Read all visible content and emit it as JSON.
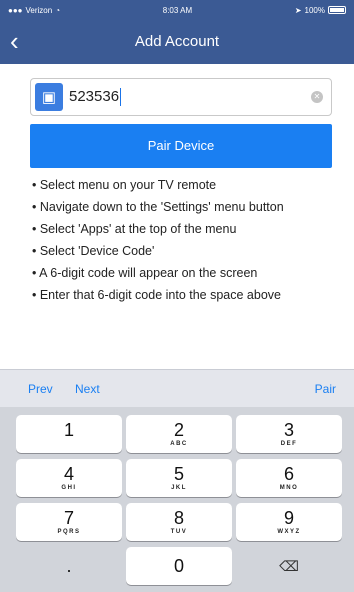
{
  "status_bar": {
    "carrier": "Verizon",
    "time": "8:03 AM",
    "battery": "100%"
  },
  "nav": {
    "back_icon": "chevron-left-icon",
    "title": "Add Account"
  },
  "code_field": {
    "icon": "tv-icon",
    "value": "523536",
    "clear_icon": "clear-icon"
  },
  "pair_button": {
    "label": "Pair Device"
  },
  "instructions": [
    "• Select menu on your TV remote",
    "• Navigate down to the 'Settings' menu button",
    "• Select 'Apps' at the top of the menu",
    "• Select 'Device Code'",
    "• A 6-digit code will appear on the screen",
    "• Enter that 6-digit code into the space above"
  ],
  "toolbar": {
    "prev": "Prev",
    "next": "Next",
    "pair": "Pair"
  },
  "keypad": {
    "keys": [
      {
        "num": "1",
        "letters": ""
      },
      {
        "num": "2",
        "letters": "ABC"
      },
      {
        "num": "3",
        "letters": "DEF"
      },
      {
        "num": "4",
        "letters": "GHI"
      },
      {
        "num": "5",
        "letters": "JKL"
      },
      {
        "num": "6",
        "letters": "MNO"
      },
      {
        "num": "7",
        "letters": "PQRS"
      },
      {
        "num": "8",
        "letters": "TUV"
      },
      {
        "num": "9",
        "letters": "WXYZ"
      }
    ],
    "dot": ".",
    "zero": "0",
    "delete_icon": "backspace-icon"
  },
  "colors": {
    "nav_background": "#3b5a94",
    "accent": "#1a7ff2"
  }
}
